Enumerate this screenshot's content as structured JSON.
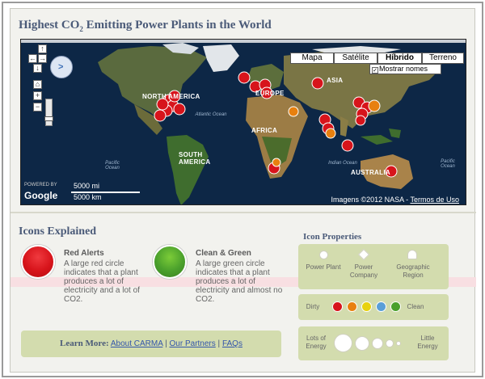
{
  "page": {
    "title_pre": "Highest CO",
    "title_sub": "2",
    "title_post": " Emitting Power Plants in the World"
  },
  "map": {
    "types": [
      "Mapa",
      "Satélite",
      "Híbrido",
      "Terreno"
    ],
    "active_type": "Híbrido",
    "show_labels": "Mostrar nomes",
    "show_labels_checked": true,
    "scale_mi": "5000 mi",
    "scale_km": "5000 km",
    "attribution": "Imagens ©2012 NASA -",
    "terms": "Termos de Uso",
    "logo": "Google",
    "powered": "POWERED BY",
    "continents": [
      "NORTH AMERICA",
      "EUROPE",
      "ASIA",
      "AFRICA",
      "SOUTH AMERICA",
      "AUSTRALIA"
    ],
    "oceans": [
      "Atlantic Ocean",
      "Pacific Ocean",
      "Indian Ocean",
      "Pacific Ocean"
    ],
    "nav_icons": [
      "pan-up-icon",
      "pan-left-icon",
      "pan-right-icon",
      "pan-down-icon",
      "zoom-in-icon",
      "zoom-out-icon"
    ],
    "colors": {
      "dirty": "#d7141b",
      "medium": "#e8800f",
      "clean": "#4aa02c",
      "ocean": "#0d2746"
    }
  },
  "icons_explained": {
    "title": "Icons Explained",
    "red": {
      "name": "Red Alerts",
      "desc": "A large red circle indicates that a plant produces a lot of electricity and a lot of CO2."
    },
    "green": {
      "name": "Clean & Green",
      "desc": "A large green circle indicates that a plant produces a lot of electricity and almost no CO2."
    }
  },
  "learn_more": {
    "label": "Learn More:",
    "links": [
      "About CARMA",
      "Our Partners",
      "FAQs"
    ],
    "separator": "|"
  },
  "icon_properties": {
    "title": "Icon Properties",
    "shapes": [
      "Power Plant",
      "Power Company",
      "Geographic Region"
    ],
    "dirty": "Dirty",
    "clean": "Clean",
    "lots": "Lots of Energy",
    "little": "Little Energy",
    "scale_colors": [
      "#d7141b",
      "#e8800f",
      "#e8d20f",
      "#5a9fd8",
      "#4aa02c"
    ]
  }
}
